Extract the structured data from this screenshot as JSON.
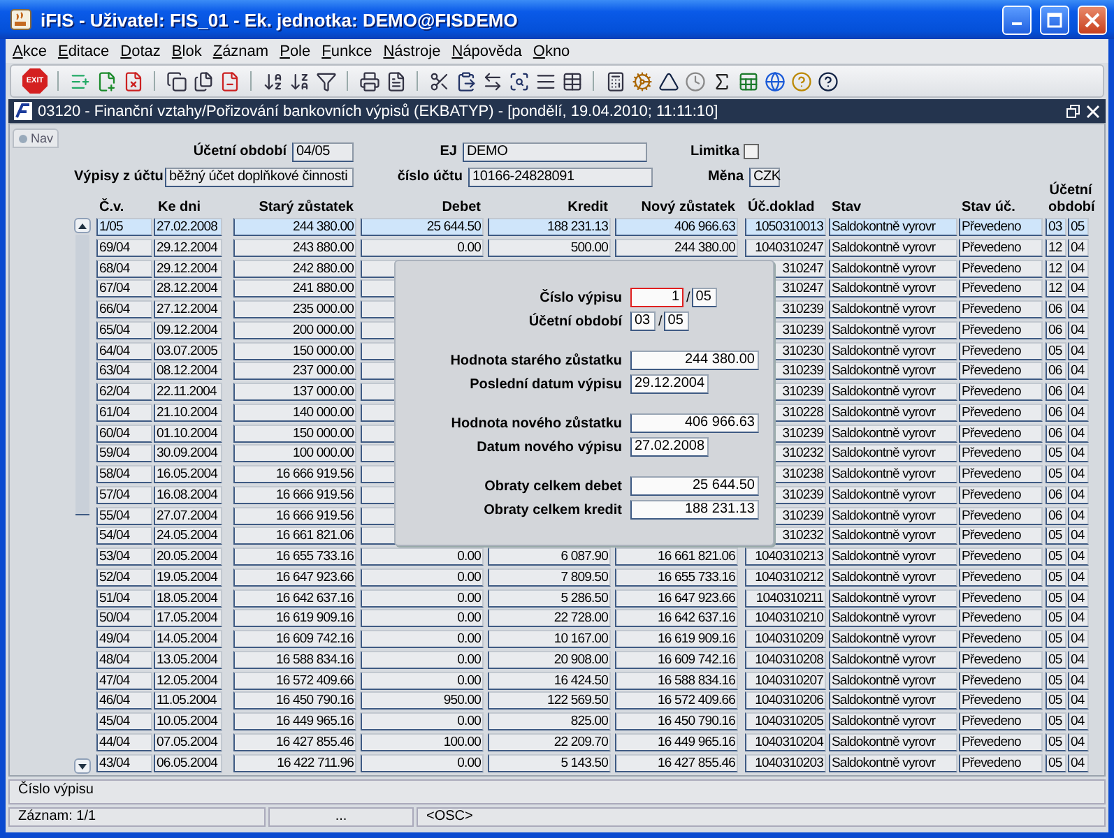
{
  "window": {
    "title": "iFIS - Uživatel: FIS_01 - Ek. jednotka: DEMO@FISDEMO"
  },
  "menu": [
    "Akce",
    "Editace",
    "Dotaz",
    "Blok",
    "Záznam",
    "Pole",
    "Funkce",
    "Nástroje",
    "Nápověda",
    "Okno"
  ],
  "toolbar": {
    "exit_label": "EXIT"
  },
  "form_window": {
    "title": "03120 - Finanční vztahy/Pořizování bankovních výpisů (EKBATYP) - [pondělí, 19.04.2010; 11:11:10]"
  },
  "nav_tab": {
    "label": "Nav"
  },
  "header": {
    "period": {
      "label": "Účetní období",
      "value": "04/05"
    },
    "ej": {
      "label": "EJ",
      "value": "DEMO"
    },
    "limitka": {
      "label": "Limitka",
      "checked": false
    },
    "statements": {
      "label": "Výpisy z účtu",
      "value": "běžný účet doplňkové činnosti"
    },
    "account": {
      "label": "číslo účtu",
      "value": "10166-24828091"
    },
    "currency": {
      "label": "Měna",
      "value": "CZK"
    }
  },
  "table": {
    "columns": [
      "Č.v.",
      "Ke dni",
      "Starý zůstatek",
      "Debet",
      "Kredit",
      "Nový zůstatek",
      "Úč.doklad",
      "Stav",
      "Stav úč.",
      "Účetní období"
    ],
    "rows": [
      {
        "selected": true,
        "cells": [
          "1/05",
          "27.02.2008",
          "244 380.00",
          "25 644.50",
          "188 231.13",
          "406 966.63",
          "1050310013",
          "Saldokontně vyrovr",
          "Převedeno",
          "03",
          "05"
        ]
      },
      {
        "selected": false,
        "cells": [
          "69/04",
          "29.12.2004",
          "243 880.00",
          "0.00",
          "500.00",
          "244 380.00",
          "1040310247",
          "Saldokontně vyrovr",
          "Převedeno",
          "12",
          "04"
        ]
      },
      {
        "selected": false,
        "cells": [
          "68/04",
          "29.12.2004",
          "242 880.00",
          null,
          null,
          null,
          "310247",
          "Saldokontně vyrovr",
          "Převedeno",
          "12",
          "04"
        ]
      },
      {
        "selected": false,
        "cells": [
          "67/04",
          "28.12.2004",
          "241 880.00",
          null,
          null,
          null,
          "310247",
          "Saldokontně vyrovr",
          "Převedeno",
          "12",
          "04"
        ]
      },
      {
        "selected": false,
        "cells": [
          "66/04",
          "27.12.2004",
          "235 000.00",
          null,
          null,
          null,
          "310239",
          "Saldokontně vyrovr",
          "Převedeno",
          "06",
          "04"
        ]
      },
      {
        "selected": false,
        "cells": [
          "65/04",
          "09.12.2004",
          "200 000.00",
          null,
          null,
          null,
          "310239",
          "Saldokontně vyrovr",
          "Převedeno",
          "06",
          "04"
        ]
      },
      {
        "selected": false,
        "cells": [
          "64/04",
          "03.07.2005",
          "150 000.00",
          null,
          null,
          null,
          "310230",
          "Saldokontně vyrovr",
          "Převedeno",
          "05",
          "04"
        ]
      },
      {
        "selected": false,
        "cells": [
          "63/04",
          "08.12.2004",
          "237 000.00",
          null,
          null,
          null,
          "310239",
          "Saldokontně vyrovr",
          "Převedeno",
          "06",
          "04"
        ]
      },
      {
        "selected": false,
        "cells": [
          "62/04",
          "22.11.2004",
          "137 000.00",
          null,
          null,
          null,
          "310239",
          "Saldokontně vyrovr",
          "Převedeno",
          "06",
          "04"
        ]
      },
      {
        "selected": false,
        "cells": [
          "61/04",
          "21.10.2004",
          "140 000.00",
          null,
          null,
          null,
          "310228",
          "Saldokontně vyrovr",
          "Převedeno",
          "06",
          "04"
        ]
      },
      {
        "selected": false,
        "cells": [
          "60/04",
          "01.10.2004",
          "150 000.00",
          null,
          null,
          null,
          "310239",
          "Saldokontně vyrovr",
          "Převedeno",
          "06",
          "04"
        ]
      },
      {
        "selected": false,
        "cells": [
          "59/04",
          "30.09.2004",
          "100 000.00",
          null,
          null,
          null,
          "310232",
          "Saldokontně vyrovr",
          "Převedeno",
          "05",
          "04"
        ]
      },
      {
        "selected": false,
        "cells": [
          "58/04",
          "16.05.2004",
          "16 666 919.56",
          null,
          null,
          null,
          "310238",
          "Saldokontně vyrovr",
          "Převedeno",
          "05",
          "04"
        ]
      },
      {
        "selected": false,
        "cells": [
          "57/04",
          "16.08.2004",
          "16 666 919.56",
          null,
          null,
          null,
          "310239",
          "Saldokontně vyrovr",
          "Převedeno",
          "06",
          "04"
        ]
      },
      {
        "selected": false,
        "cells": [
          "55/04",
          "27.07.2004",
          "16 666 919.56",
          null,
          null,
          null,
          "310239",
          "Saldokontně vyrovr",
          "Převedeno",
          "06",
          "04"
        ]
      },
      {
        "selected": false,
        "cells": [
          "54/04",
          "24.05.2004",
          "16 661 821.06",
          null,
          null,
          null,
          "310232",
          "Saldokontně vyrovr",
          "Převedeno",
          "05",
          "04"
        ]
      },
      {
        "selected": false,
        "cells": [
          "53/04",
          "20.05.2004",
          "16 655 733.16",
          "0.00",
          "6 087.90",
          "16 661 821.06",
          "1040310213",
          "Saldokontně vyrovr",
          "Převedeno",
          "05",
          "04"
        ]
      },
      {
        "selected": false,
        "cells": [
          "52/04",
          "19.05.2004",
          "16 647 923.66",
          "0.00",
          "7 809.50",
          "16 655 733.16",
          "1040310212",
          "Saldokontně vyrovr",
          "Převedeno",
          "05",
          "04"
        ]
      },
      {
        "selected": false,
        "cells": [
          "51/04",
          "18.05.2004",
          "16 642 637.16",
          "0.00",
          "5 286.50",
          "16 647 923.66",
          "1040310211",
          "Saldokontně vyrovr",
          "Převedeno",
          "05",
          "04"
        ]
      },
      {
        "selected": false,
        "cells": [
          "50/04",
          "17.05.2004",
          "16 619 909.16",
          "0.00",
          "22 728.00",
          "16 642 637.16",
          "1040310210",
          "Saldokontně vyrovr",
          "Převedeno",
          "05",
          "04"
        ]
      },
      {
        "selected": false,
        "cells": [
          "49/04",
          "14.05.2004",
          "16 609 742.16",
          "0.00",
          "10 167.00",
          "16 619 909.16",
          "1040310209",
          "Saldokontně vyrovr",
          "Převedeno",
          "05",
          "04"
        ]
      },
      {
        "selected": false,
        "cells": [
          "48/04",
          "13.05.2004",
          "16 588 834.16",
          "0.00",
          "20 908.00",
          "16 609 742.16",
          "1040310208",
          "Saldokontně vyrovr",
          "Převedeno",
          "05",
          "04"
        ]
      },
      {
        "selected": false,
        "cells": [
          "47/04",
          "12.05.2004",
          "16 572 409.66",
          "0.00",
          "16 424.50",
          "16 588 834.16",
          "1040310207",
          "Saldokontně vyrovr",
          "Převedeno",
          "05",
          "04"
        ]
      },
      {
        "selected": false,
        "cells": [
          "46/04",
          "11.05.2004",
          "16 450 790.16",
          "950.00",
          "122 569.50",
          "16 572 409.66",
          "1040310206",
          "Saldokontně vyrovr",
          "Převedeno",
          "05",
          "04"
        ]
      },
      {
        "selected": false,
        "cells": [
          "45/04",
          "10.05.2004",
          "16 449 965.16",
          "0.00",
          "825.00",
          "16 450 790.16",
          "1040310205",
          "Saldokontně vyrovr",
          "Převedeno",
          "05",
          "04"
        ]
      },
      {
        "selected": false,
        "cells": [
          "44/04",
          "07.05.2004",
          "16 427 855.46",
          "100.00",
          "22 209.70",
          "16 449 965.16",
          "1040310204",
          "Saldokontně vyrovr",
          "Převedeno",
          "05",
          "04"
        ]
      },
      {
        "selected": false,
        "cells": [
          "43/04",
          "06.05.2004",
          "16 422 711.96",
          "0.00",
          "5 143.50",
          "16 427 855.46",
          "1040310203",
          "Saldokontně vyrovr",
          "Převedeno",
          "05",
          "04"
        ]
      }
    ]
  },
  "dialog": {
    "groups": [
      [
        {
          "label": "Číslo výpisu",
          "separator": "/",
          "fields": [
            {
              "kind": "number",
              "value": "1",
              "focused": true
            },
            {
              "kind": "code",
              "value": "05",
              "focused": false
            }
          ]
        },
        {
          "label": "Účetní období",
          "separator": "/",
          "fields": [
            {
              "kind": "code",
              "value": "03",
              "focused": false
            },
            {
              "kind": "code",
              "value": "05",
              "focused": false
            }
          ]
        }
      ],
      [
        {
          "label": "Hodnota starého zůstatku",
          "fields": [
            {
              "kind": "amount",
              "value": "244 380.00",
              "focused": false
            }
          ]
        },
        {
          "label": "Poslední datum výpisu",
          "fields": [
            {
              "kind": "date",
              "value": "29.12.2004",
              "focused": false
            }
          ]
        }
      ],
      [
        {
          "label": "Hodnota nového zůstatku",
          "fields": [
            {
              "kind": "amount",
              "value": "406 966.63",
              "focused": false
            }
          ]
        },
        {
          "label": "Datum nového výpisu",
          "fields": [
            {
              "kind": "date",
              "value": "27.02.2008",
              "focused": false
            }
          ]
        }
      ],
      [
        {
          "label": "Obraty celkem debet",
          "fields": [
            {
              "kind": "amount",
              "value": "25 644.50",
              "focused": false
            }
          ]
        },
        {
          "label": "Obraty celkem kredit",
          "fields": [
            {
              "kind": "amount",
              "value": "188 231.13",
              "focused": false
            }
          ]
        }
      ]
    ]
  },
  "status_bar": {
    "hint": "Číslo výpisu",
    "record": "Záznam: 1/1",
    "segment_2": "...",
    "mode": "<OSC>"
  }
}
